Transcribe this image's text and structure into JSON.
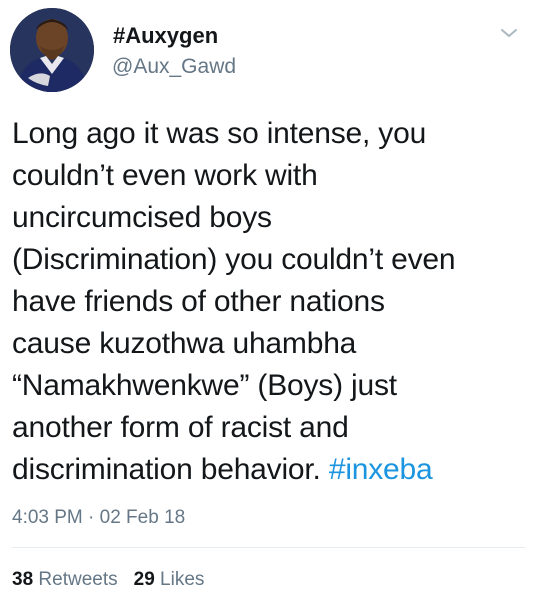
{
  "tweet": {
    "display_name": "#Auxygen",
    "handle": "@Aux_Gawd",
    "icons": {
      "avatar": "user-avatar-photo",
      "menu": "chevron-down-icon"
    },
    "body_lines": [
      "Long ago it was so intense, you",
      "couldn’t even work with",
      "uncircumcised boys",
      "(Discrimination) you couldn’t even",
      "have friends of other nations",
      "cause kuzothwa uhambha",
      "“Namakhwenkwe” (Boys) just",
      "another form of racist and"
    ],
    "last_line_text": "discrimination behavior. ",
    "hashtag": "#inxeba",
    "timestamp": "4:03 PM · 02 Feb 18",
    "retweets_count": "38",
    "retweets_label": "Retweets",
    "likes_count": "29",
    "likes_label": "Likes",
    "colors": {
      "text": "#14171a",
      "secondary": "#657786",
      "link": "#1b95e0",
      "divider": "#e6ecf0"
    }
  }
}
